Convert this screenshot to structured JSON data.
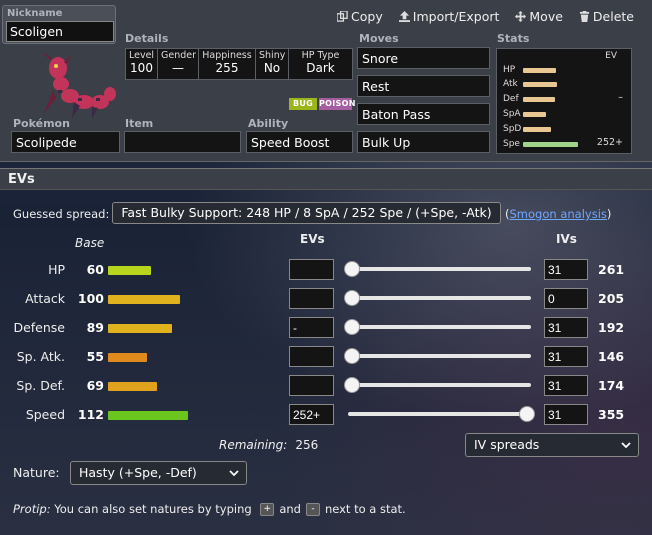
{
  "toolbar": {
    "copy": "Copy",
    "import_export": "Import/Export",
    "move": "Move",
    "delete": "Delete"
  },
  "nickname": {
    "label": "Nickname",
    "value": "Scoligen"
  },
  "details": {
    "label": "Details",
    "level_label": "Level",
    "level": "100",
    "gender_label": "Gender",
    "gender": "—",
    "happiness_label": "Happiness",
    "happiness": "255",
    "shiny_label": "Shiny",
    "shiny": "No",
    "hptype_label": "HP Type",
    "hptype": "Dark"
  },
  "types": [
    {
      "name": "BUG",
      "color": "#9bb51b"
    },
    {
      "name": "POISON",
      "color": "#a55ea1"
    }
  ],
  "pokemon": {
    "label": "Pokémon",
    "value": "Scolipede"
  },
  "item": {
    "label": "Item",
    "value": ""
  },
  "ability": {
    "label": "Ability",
    "value": "Speed Boost"
  },
  "moves": {
    "label": "Moves",
    "list": [
      "Snore",
      "Rest",
      "Baton Pass",
      "Bulk Up"
    ]
  },
  "stats_summary": {
    "label": "Stats",
    "ev_label": "EV",
    "rows": [
      {
        "name": "HP",
        "bar_fraction": 0.6,
        "ev": ""
      },
      {
        "name": "Atk",
        "bar_fraction": 0.62,
        "ev": ""
      },
      {
        "name": "Def",
        "bar_fraction": 0.58,
        "ev": "–"
      },
      {
        "name": "SpA",
        "bar_fraction": 0.42,
        "ev": ""
      },
      {
        "name": "SpD",
        "bar_fraction": 0.5,
        "ev": ""
      },
      {
        "name": "Spe",
        "bar_fraction": 1.0,
        "ev": "252+"
      }
    ]
  },
  "evs_section": {
    "title": "EVs",
    "guessed_label": "Guessed spread:",
    "guessed_value": "Fast Bulky Support: 248 HP / 8 SpA / 252 Spe / (+Spe, -Atk)",
    "smogon_open": "(",
    "smogon_link": "Smogon analysis",
    "smogon_close": ")",
    "col_base": "Base",
    "col_evs": "EVs",
    "col_ivs": "IVs",
    "stats": [
      {
        "name": "HP",
        "base": "60",
        "ev": "",
        "ev_fraction": 0.0,
        "iv": "31",
        "total": "261",
        "color": "#b6d51c"
      },
      {
        "name": "Attack",
        "base": "100",
        "ev": "",
        "ev_fraction": 0.0,
        "iv": "0",
        "total": "205",
        "color": "#e0b21d"
      },
      {
        "name": "Defense",
        "base": "89",
        "ev": "-",
        "ev_fraction": 0.0,
        "iv": "31",
        "total": "192",
        "color": "#e0b21d"
      },
      {
        "name": "Sp. Atk.",
        "base": "55",
        "ev": "",
        "ev_fraction": 0.0,
        "iv": "31",
        "total": "146",
        "color": "#e08a1d"
      },
      {
        "name": "Sp. Def.",
        "base": "69",
        "ev": "",
        "ev_fraction": 0.0,
        "iv": "31",
        "total": "174",
        "color": "#e0a21d"
      },
      {
        "name": "Speed",
        "base": "112",
        "ev": "252+",
        "ev_fraction": 1.0,
        "iv": "31",
        "total": "355",
        "color": "#6ac61c"
      }
    ],
    "remaining_label": "Remaining:",
    "remaining_value": "256",
    "iv_spreads": "IV spreads",
    "nature_label": "Nature:",
    "nature_value": "Hasty (+Spe, -Def)",
    "protip_label": "Protip:",
    "protip_text1": "You can also set natures by typing",
    "protip_key_plus": "+",
    "protip_and": "and",
    "protip_key_minus": "-",
    "protip_text2": "next to a stat."
  }
}
